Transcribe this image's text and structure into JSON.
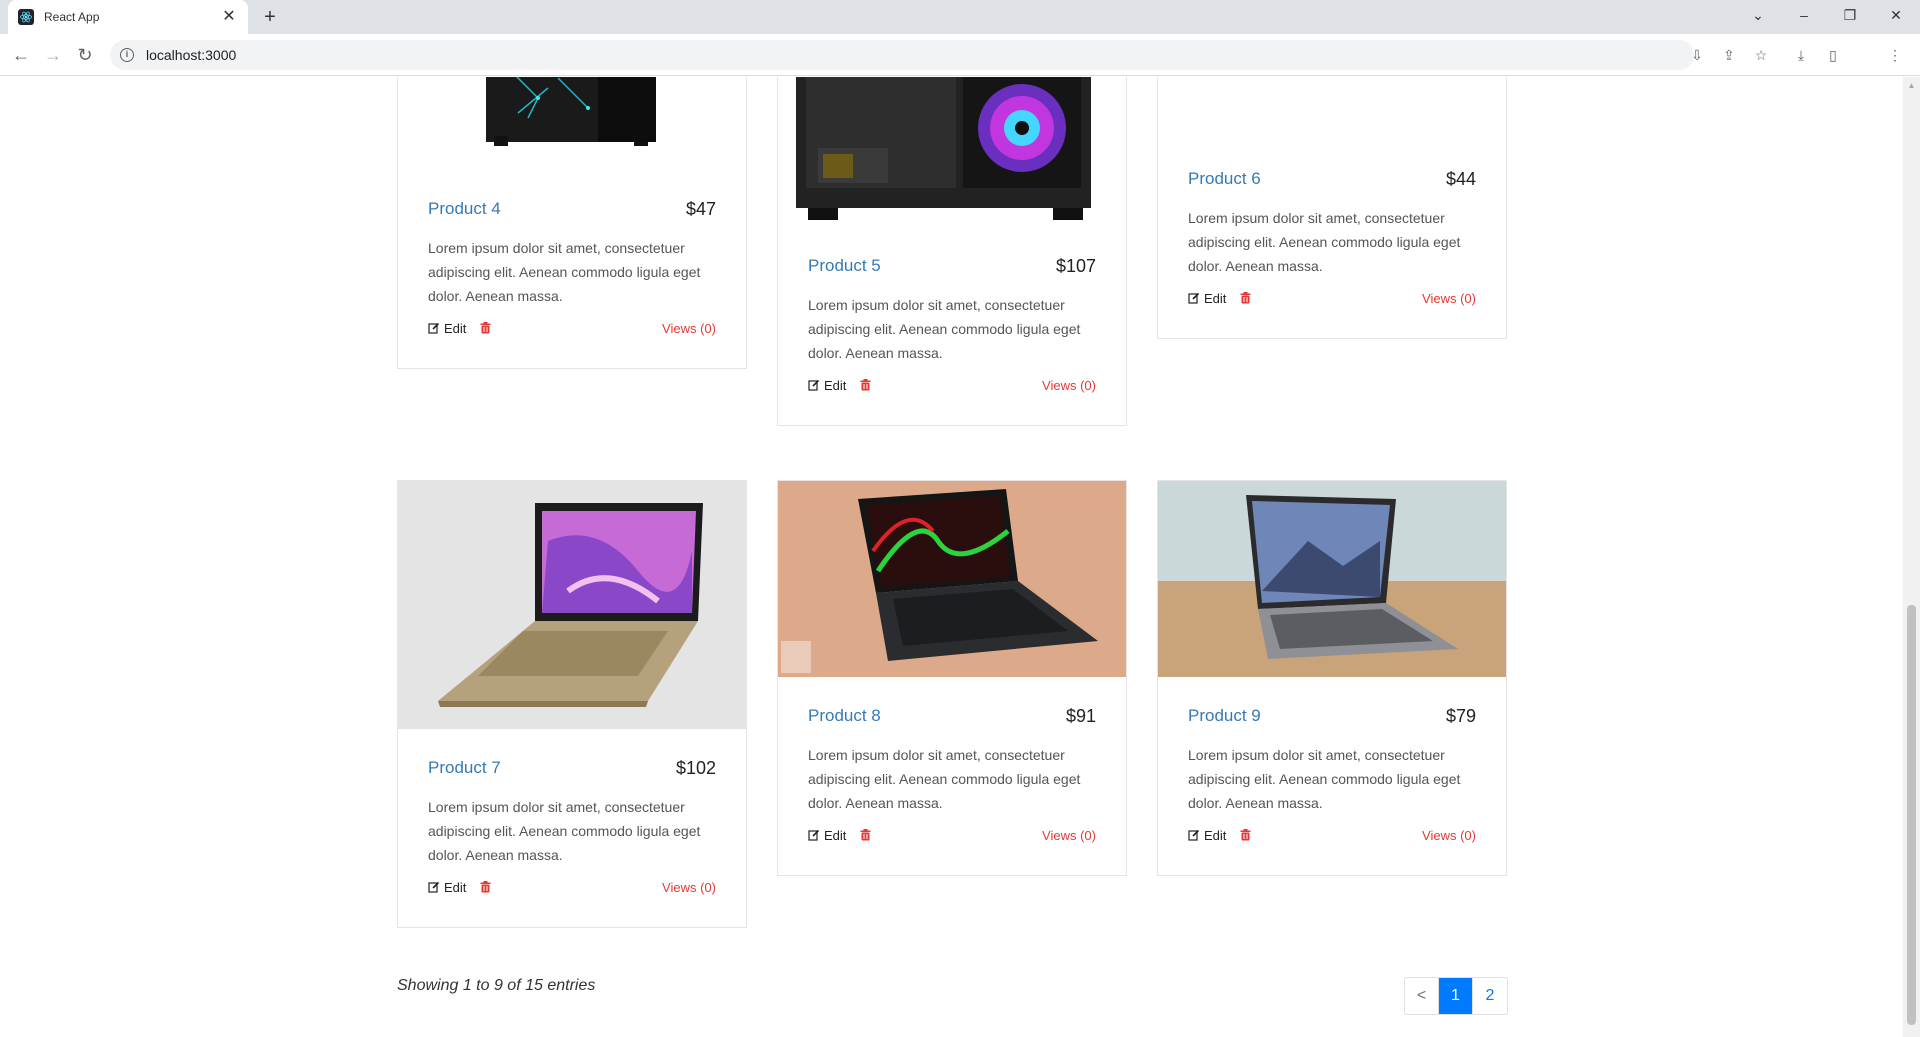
{
  "browser": {
    "tab_title": "React App",
    "tab_close": "✕",
    "new_tab": "+",
    "url": "localhost:3000"
  },
  "products": [
    {
      "name": "Product 4",
      "price": "$47",
      "desc": "Lorem ipsum dolor sit amet, consectetuer adipiscing elit. Aenean commodo ligula eget dolor. Aenean massa.",
      "edit": "Edit",
      "views": "Views (0)"
    },
    {
      "name": "Product 5",
      "price": "$107",
      "desc": "Lorem ipsum dolor sit amet, consectetuer adipiscing elit. Aenean commodo ligula eget dolor. Aenean massa.",
      "edit": "Edit",
      "views": "Views (0)"
    },
    {
      "name": "Product 6",
      "price": "$44",
      "desc": "Lorem ipsum dolor sit amet, consectetuer adipiscing elit. Aenean commodo ligula eget dolor. Aenean massa.",
      "edit": "Edit",
      "views": "Views (0)"
    },
    {
      "name": "Product 7",
      "price": "$102",
      "desc": "Lorem ipsum dolor sit amet, consectetuer adipiscing elit. Aenean commodo ligula eget dolor. Aenean massa.",
      "edit": "Edit",
      "views": "Views (0)"
    },
    {
      "name": "Product 8",
      "price": "$91",
      "desc": "Lorem ipsum dolor sit amet, consectetuer adipiscing elit. Aenean commodo ligula eget dolor. Aenean massa.",
      "edit": "Edit",
      "views": "Views (0)"
    },
    {
      "name": "Product 9",
      "price": "$79",
      "desc": "Lorem ipsum dolor sit amet, consectetuer adipiscing elit. Aenean commodo ligula eget dolor. Aenean massa.",
      "edit": "Edit",
      "views": "Views (0)"
    }
  ],
  "footer": {
    "showing": "Showing 1 to 9 of 15 entries"
  },
  "pagination": {
    "prev": "<",
    "pages": [
      "1",
      "2"
    ],
    "active": "1"
  },
  "colors": {
    "link": "#337ab7",
    "views": "#e53935",
    "trash": "#e53935",
    "active_page": "#007bff"
  }
}
